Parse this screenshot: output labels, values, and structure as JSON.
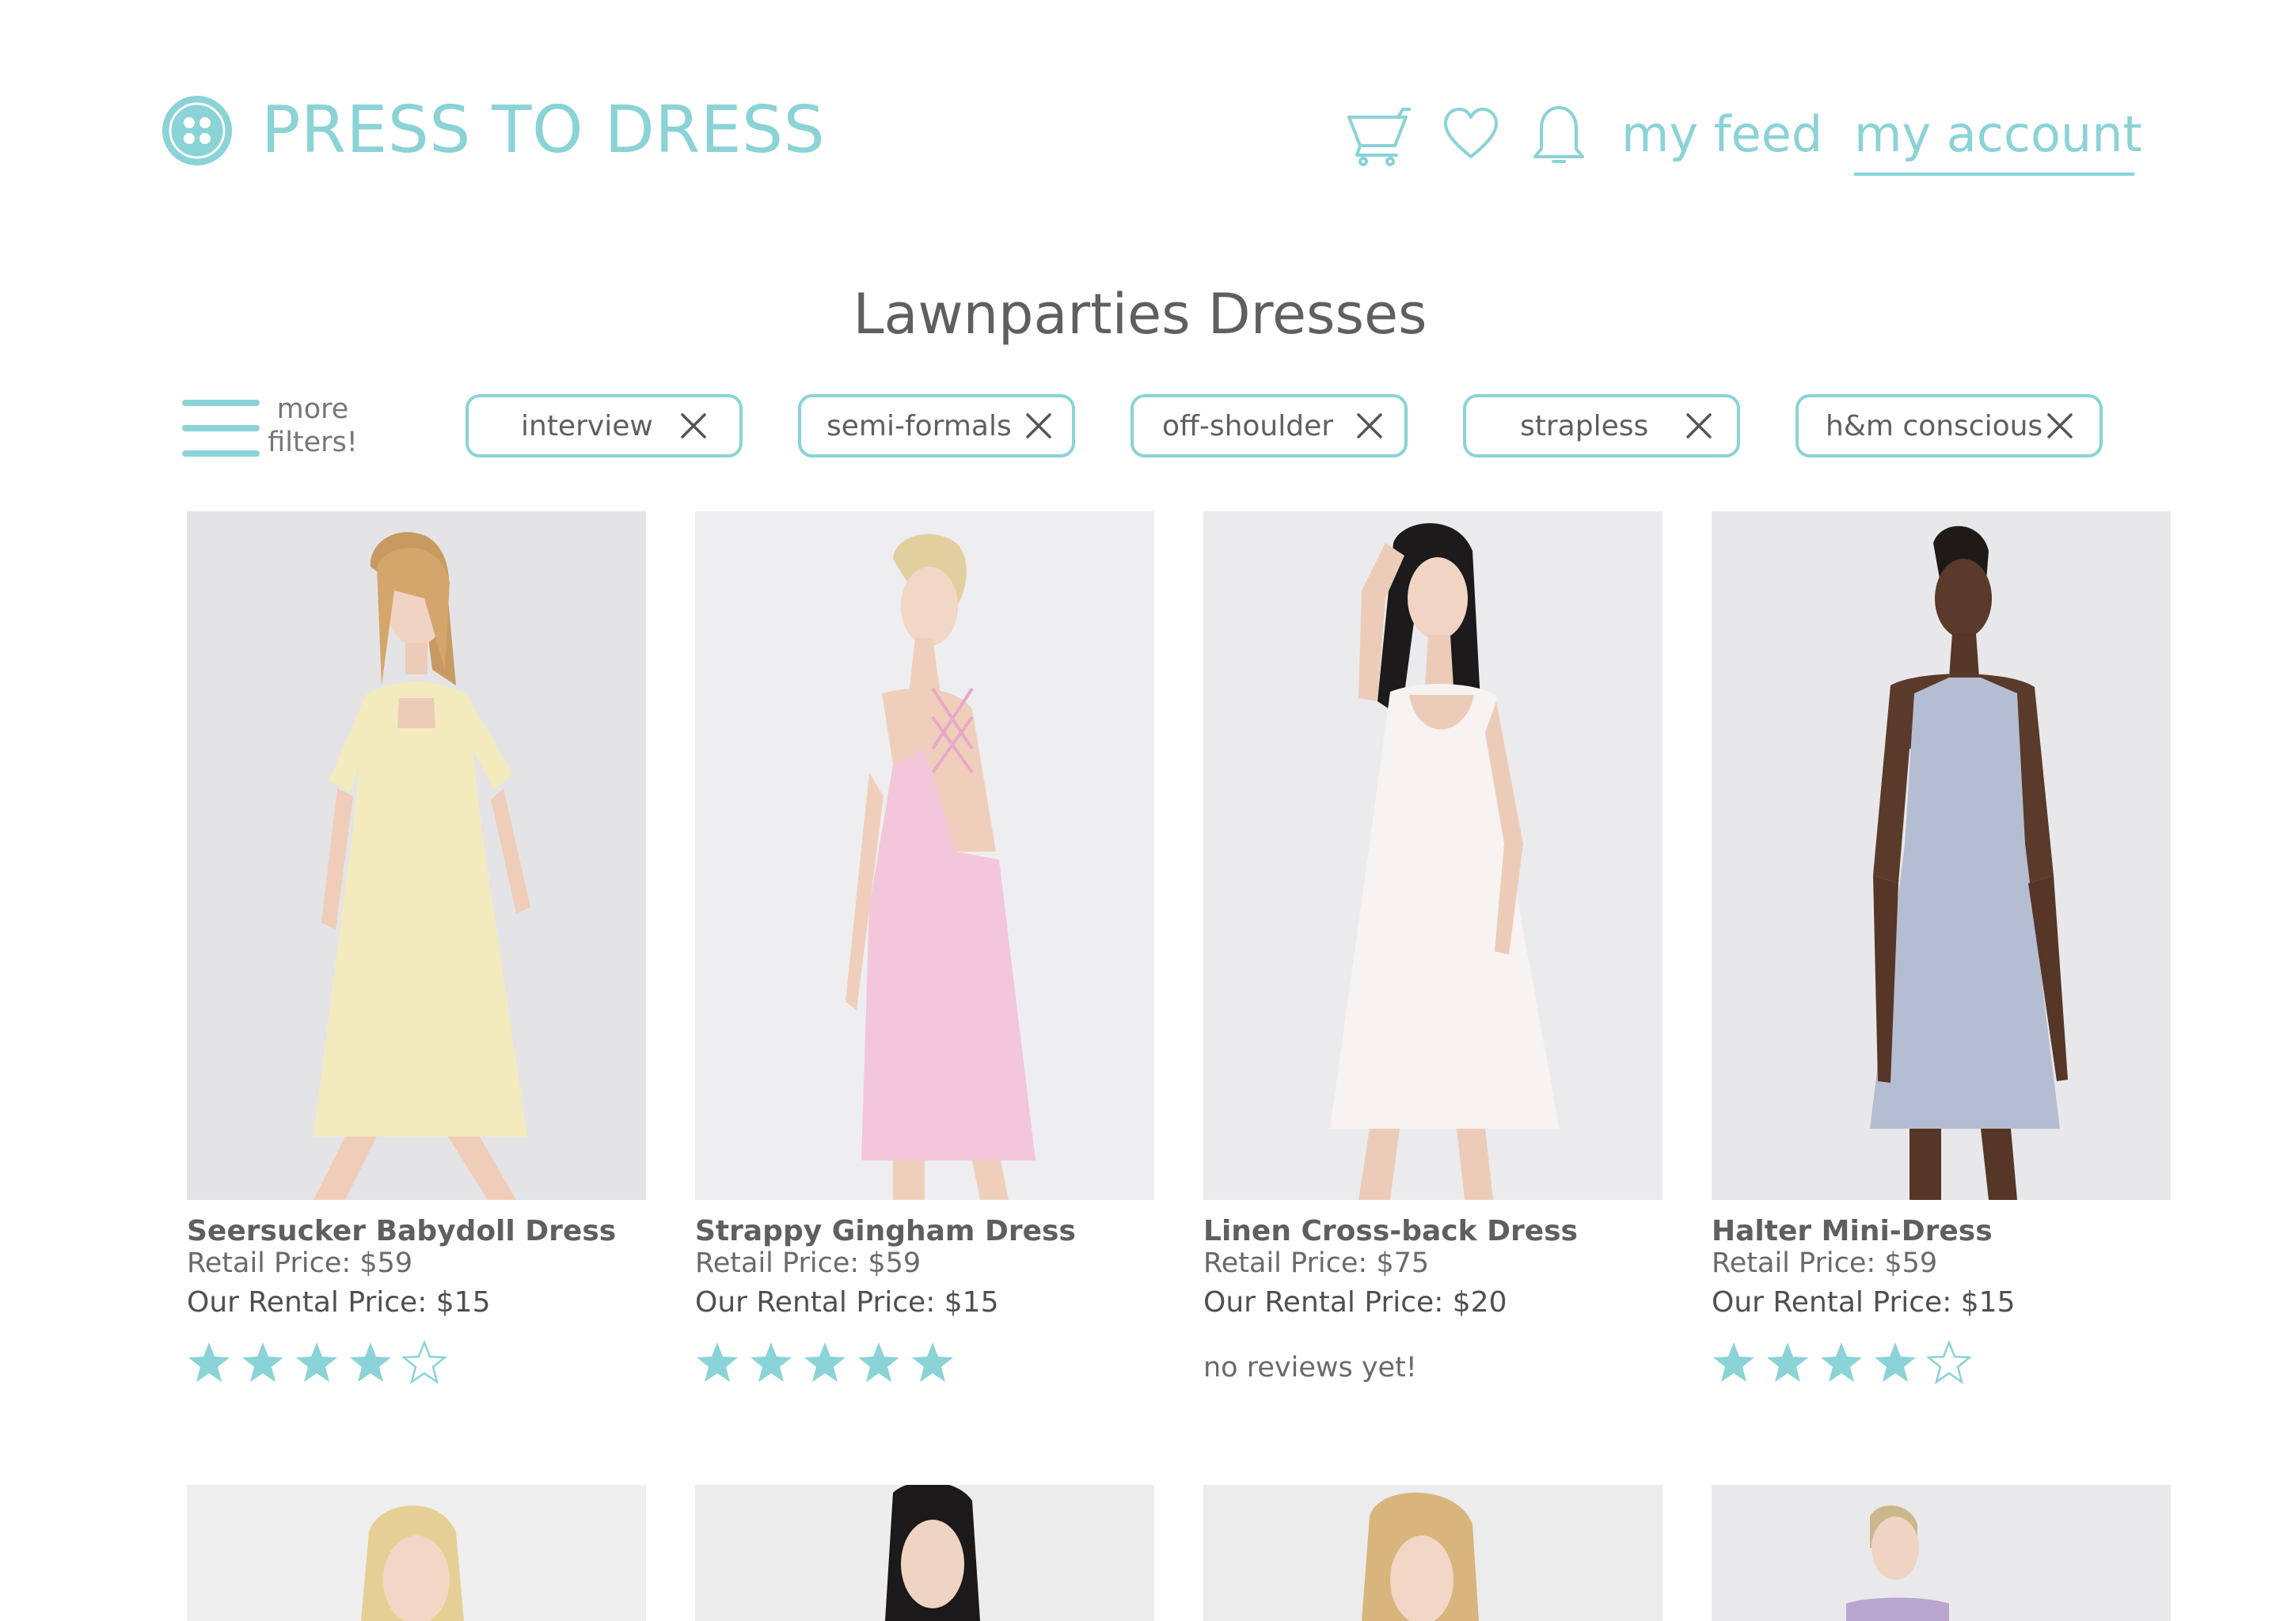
{
  "header": {
    "brand": "PRESS TO DRESS",
    "nav": {
      "my_feed": "my feed",
      "my_account": "my account"
    },
    "icons": [
      "button-logo-icon",
      "cart-icon",
      "heart-icon",
      "bell-icon"
    ]
  },
  "page_title": "Lawnparties Dresses",
  "filters": {
    "more_label_line1": "more",
    "more_label_line2": "filters!",
    "chips": [
      "interview",
      "semi-formals",
      "off-shoulder",
      "strapless",
      "h&m conscious"
    ]
  },
  "products": [
    {
      "name": "Seersucker Babydoll Dress",
      "retail": "Retail Price: $59",
      "rental": "Our Rental Price: $15",
      "rating": 4,
      "review_note": ""
    },
    {
      "name": "Strappy Gingham Dress",
      "retail": "Retail Price: $59",
      "rental": "Our Rental Price: $15",
      "rating": 5,
      "review_note": ""
    },
    {
      "name": "Linen Cross-back Dress",
      "retail": "Retail Price: $75",
      "rental": "Our Rental Price: $20",
      "rating": 0,
      "review_note": "no reviews yet!"
    },
    {
      "name": "Halter Mini-Dress",
      "retail": "Retail Price: $59",
      "rental": "Our Rental Price: $15",
      "rating": 4,
      "review_note": ""
    }
  ],
  "colors": {
    "accent": "#8ad3d6",
    "text": "#5f5f5f",
    "star_filled": "#8ad3d6"
  }
}
